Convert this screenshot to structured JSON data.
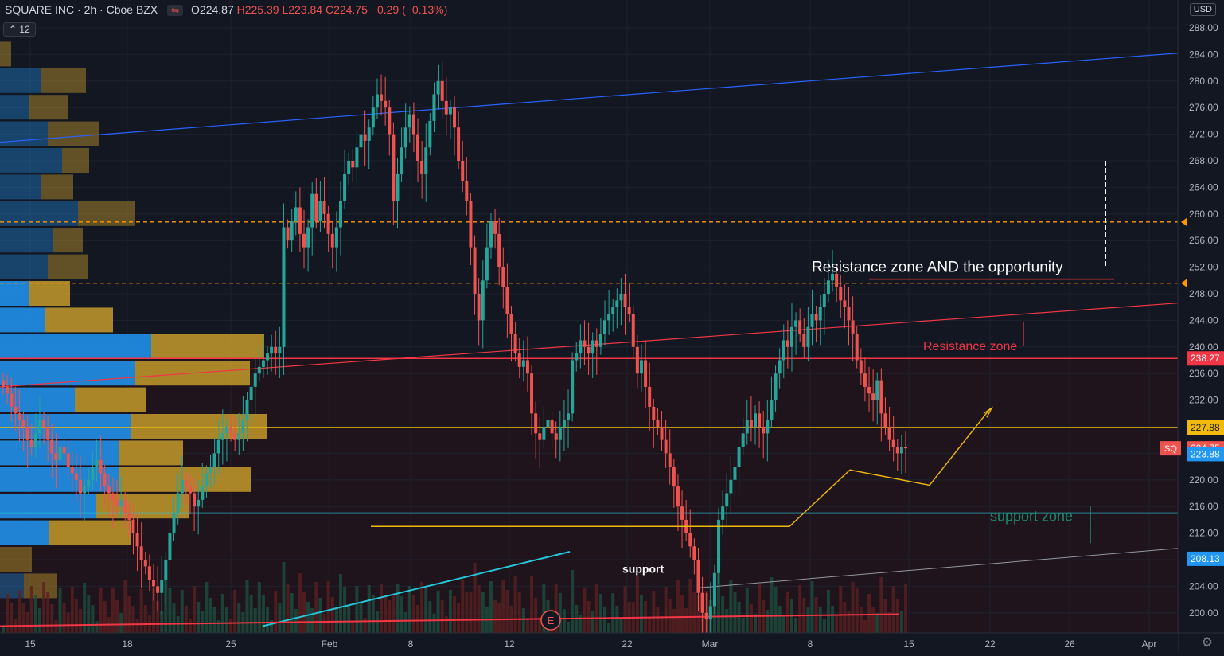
{
  "header": {
    "symbol": "SQUARE INC · 2h · Cboe BZX",
    "open": "O224.87",
    "high": "H225.39",
    "low": "L223.84",
    "close": "C224.75",
    "change": "−0.29 (−0.13%)",
    "volume_label": "12",
    "currency": "USD"
  },
  "colors": {
    "background": "#131722",
    "up": "#26a69a",
    "down": "#ef5350",
    "resistance": "#f23645",
    "support": "#26c6da",
    "path": "#f0b90b",
    "profile_blue": "#2196f3",
    "profile_gold": "#c49a2c"
  },
  "chart_data": {
    "type": "candlestick",
    "y_axis": {
      "min": 198,
      "max": 290,
      "ticks": [
        "288.00",
        "284.00",
        "280.00",
        "276.00",
        "272.00",
        "268.00",
        "264.00",
        "260.00",
        "256.00",
        "252.00",
        "248.00",
        "244.00",
        "240.00",
        "236.00",
        "232.00",
        "228.00",
        "224.00",
        "220.00",
        "216.00",
        "212.00",
        "208.00",
        "204.00",
        "200.00"
      ]
    },
    "x_axis": {
      "ticks": [
        "15",
        "18",
        "25",
        "Feb",
        "8",
        "12",
        "22",
        "Mar",
        "8",
        "15",
        "22",
        "26",
        "Apr"
      ]
    },
    "price_labels": [
      {
        "value": 238.27,
        "text": "238.27",
        "color": "#f23645"
      },
      {
        "value": 227.88,
        "text": "227.88",
        "color": "#f0b90b"
      },
      {
        "value": 224.75,
        "text": "224.75",
        "color": "#ef5350",
        "tag": "SQ"
      },
      {
        "value": 223.88,
        "text": "223.88",
        "color": "#2196f3"
      },
      {
        "value": 208.13,
        "text": "208.13",
        "color": "#2196f3"
      }
    ],
    "horizontal_levels": [
      {
        "value": 258.8,
        "style": "dashed",
        "color": "#ff9800"
      },
      {
        "value": 249.6,
        "style": "dashed",
        "color": "#ff9800"
      },
      {
        "value": 238.27,
        "style": "solid",
        "color": "#f23645"
      },
      {
        "value": 227.88,
        "style": "solid",
        "color": "#f0b90b"
      },
      {
        "value": 215.0,
        "style": "solid",
        "color": "#26c6da"
      }
    ],
    "annotations": [
      {
        "text": "Resistance zone AND the opportunity",
        "color": "#ffffff"
      },
      {
        "text": "Resistance zone",
        "color": "#f23645"
      },
      {
        "text": "support zone",
        "color": "#1a8a6e"
      },
      {
        "text": "support",
        "color": "#ffffff"
      },
      {
        "text": "E",
        "color": "#ef5350"
      }
    ],
    "candles_close": [
      234,
      233,
      231,
      230,
      229,
      228,
      226,
      225,
      227,
      229,
      228,
      226,
      224,
      223,
      225,
      224,
      222,
      221,
      220,
      218,
      219,
      220,
      222,
      223,
      221,
      219,
      218,
      217,
      216,
      217,
      215,
      214,
      212,
      210,
      208,
      207,
      205,
      204,
      203,
      205,
      208,
      212,
      215,
      218,
      220,
      219,
      218,
      216,
      217,
      219,
      221,
      222,
      224,
      226,
      227,
      228,
      227,
      226,
      227,
      229,
      232,
      234,
      236,
      237,
      238,
      239,
      240,
      239,
      240,
      258,
      256,
      259,
      261,
      257,
      255,
      258,
      263,
      259,
      262,
      260,
      257,
      255,
      258,
      262,
      266,
      268,
      267,
      270,
      272,
      271,
      273,
      276,
      278,
      277,
      276,
      272,
      262,
      266,
      270,
      273,
      275,
      272,
      268,
      266,
      270,
      274,
      278,
      280,
      277,
      275,
      276,
      273,
      268,
      265,
      262,
      255,
      248,
      244,
      250,
      255,
      259,
      257,
      252,
      249,
      245,
      242,
      239,
      237,
      238,
      236,
      230,
      227,
      226,
      228,
      229,
      227,
      226,
      228,
      229,
      230,
      238,
      239,
      241,
      240,
      239,
      241,
      240,
      242,
      244,
      245,
      246,
      247,
      248,
      246,
      245,
      240,
      236,
      238,
      234,
      231,
      229,
      228,
      226,
      224,
      222,
      219,
      216,
      214,
      212,
      210,
      208,
      203,
      200,
      199,
      201,
      206,
      214,
      216,
      218,
      220,
      222,
      225,
      227,
      229,
      228,
      230,
      228,
      227,
      229,
      232,
      236,
      238,
      241,
      240,
      243,
      244,
      242,
      240,
      243,
      245,
      244,
      246,
      248,
      250,
      251,
      249,
      247,
      246,
      244,
      242,
      238,
      236,
      234,
      233,
      232,
      235,
      230,
      228,
      226,
      225,
      224,
      225,
      224.75
    ],
    "volume_profile": [
      {
        "price": 284,
        "up": 0,
        "down": 14
      },
      {
        "price": 280,
        "up": 52,
        "down": 56
      },
      {
        "price": 276,
        "up": 36,
        "down": 50
      },
      {
        "price": 272,
        "up": 60,
        "down": 64
      },
      {
        "price": 268,
        "up": 78,
        "down": 34
      },
      {
        "price": 264,
        "up": 52,
        "down": 40
      },
      {
        "price": 260,
        "up": 98,
        "down": 72
      },
      {
        "price": 256,
        "up": 66,
        "down": 38
      },
      {
        "price": 252,
        "up": 60,
        "down": 50
      },
      {
        "price": 248,
        "up": 36,
        "down": 52
      },
      {
        "price": 244,
        "up": 56,
        "down": 86
      },
      {
        "price": 240,
        "up": 190,
        "down": 142
      },
      {
        "price": 236,
        "up": 170,
        "down": 144
      },
      {
        "price": 232,
        "up": 94,
        "down": 90
      },
      {
        "price": 228,
        "up": 165,
        "down": 170
      },
      {
        "price": 224,
        "up": 150,
        "down": 80
      },
      {
        "price": 220,
        "up": 150,
        "down": 166
      },
      {
        "price": 216,
        "up": 120,
        "down": 118
      },
      {
        "price": 212,
        "up": 62,
        "down": 102
      },
      {
        "price": 208,
        "up": 0,
        "down": 40
      },
      {
        "price": 204,
        "up": 30,
        "down": 42
      }
    ]
  }
}
